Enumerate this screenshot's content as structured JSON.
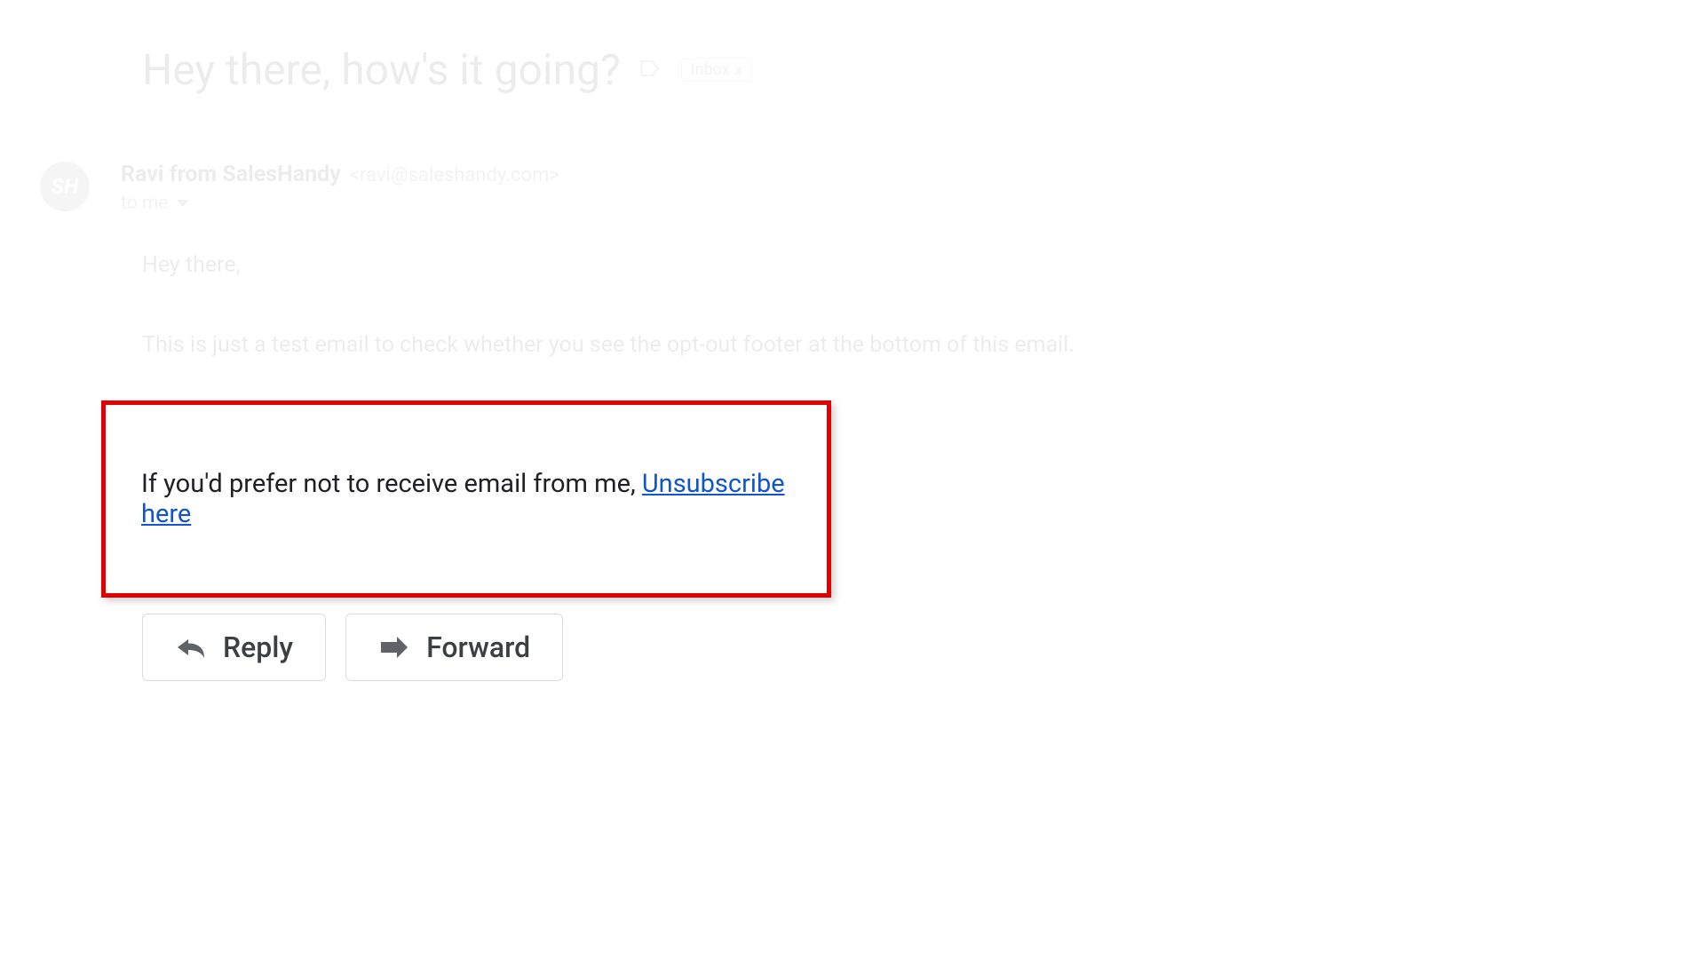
{
  "email": {
    "subject": "Hey there, how's it going?",
    "inbox_label": "Inbox",
    "inbox_close": "x",
    "avatar_text": "SH",
    "sender_name": "Ravi from SalesHandy",
    "sender_email": "<ravi@saleshandy.com>",
    "recipient": "to me",
    "greeting": "Hey there,",
    "body": "This is just a test email to check whether you see the opt-out footer at the bottom of this email."
  },
  "unsubscribe": {
    "text": "If you'd prefer not to receive email from me, ",
    "link": "Unsubscribe here"
  },
  "actions": {
    "reply": "Reply",
    "forward": "Forward"
  }
}
